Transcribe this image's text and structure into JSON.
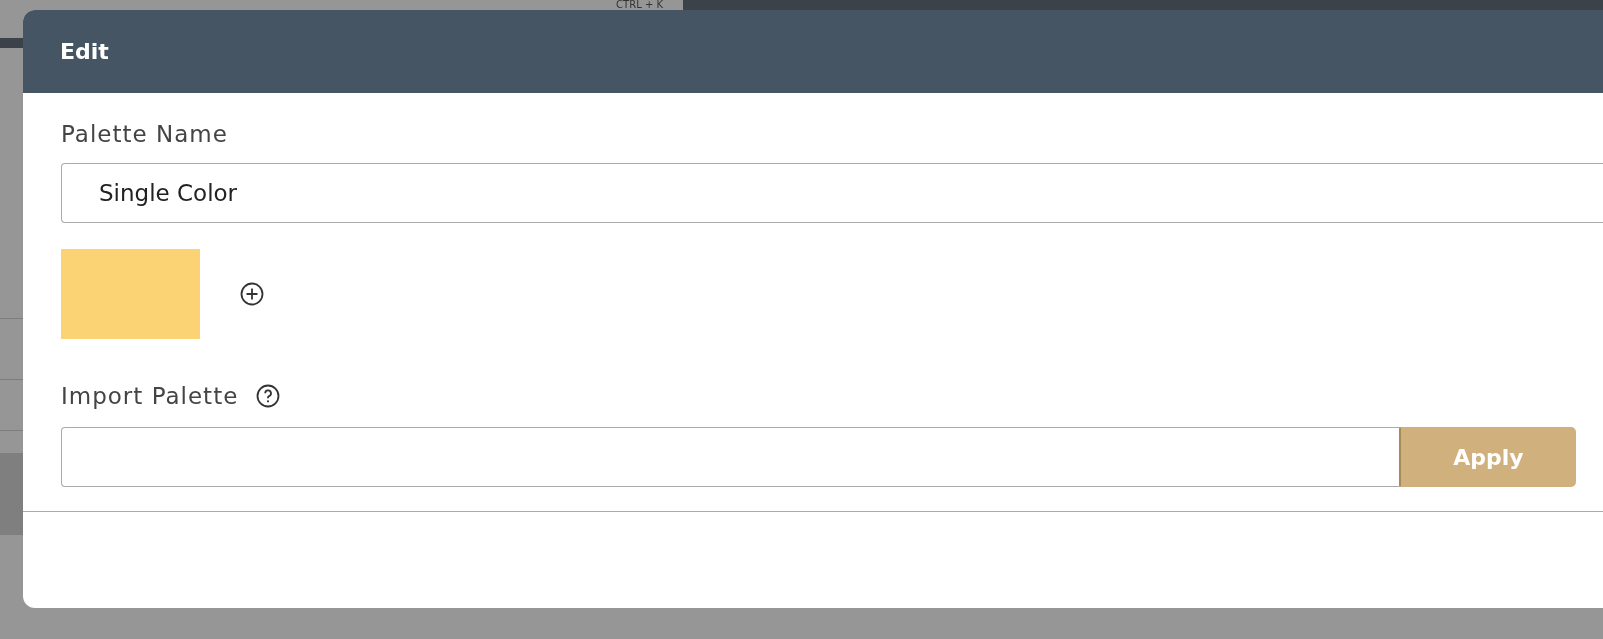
{
  "background": {
    "shortcut_hint": "CTRL + K"
  },
  "dialog": {
    "title": "Edit",
    "palette_name": {
      "label": "Palette Name",
      "value": "Single Color"
    },
    "colors": [
      {
        "color": "#fbd375"
      }
    ],
    "import_palette": {
      "label": "Import Palette",
      "button": "Apply"
    }
  }
}
